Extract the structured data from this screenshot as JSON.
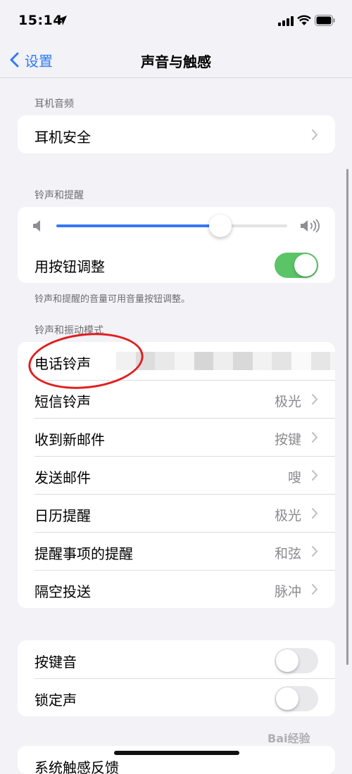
{
  "status_bar": {
    "time": "15:14"
  },
  "nav": {
    "back_label": "设置",
    "title": "声音与触感"
  },
  "sections": {
    "headphone": {
      "header": "耳机音频",
      "rows": [
        {
          "label": "耳机安全"
        }
      ]
    },
    "ringer": {
      "header": "铃声和提醒",
      "volume_level": 0.71,
      "adjust_with_buttons": {
        "label": "用按钮调整",
        "on": true
      },
      "footer": "铃声和提醒的音量可用音量按钮调整。"
    },
    "sounds": {
      "header": "铃声和振动模式",
      "rows": [
        {
          "label": "电话铃声",
          "value": ""
        },
        {
          "label": "短信铃声",
          "value": "极光"
        },
        {
          "label": "收到新邮件",
          "value": "按键"
        },
        {
          "label": "发送邮件",
          "value": "嗖"
        },
        {
          "label": "日历提醒",
          "value": "极光"
        },
        {
          "label": "提醒事项的提醒",
          "value": "和弦"
        },
        {
          "label": "隔空投送",
          "value": "脉冲"
        }
      ]
    },
    "clicks": {
      "rows": [
        {
          "label": "按键音",
          "on": false
        },
        {
          "label": "锁定声",
          "on": false
        }
      ]
    },
    "partial": {
      "label": "系统触感反馈"
    }
  },
  "watermark": "Bai经验",
  "colors": {
    "accent": "#2f7bf5",
    "toggle_on": "#5bc467",
    "annotation": "#e01f1f"
  }
}
